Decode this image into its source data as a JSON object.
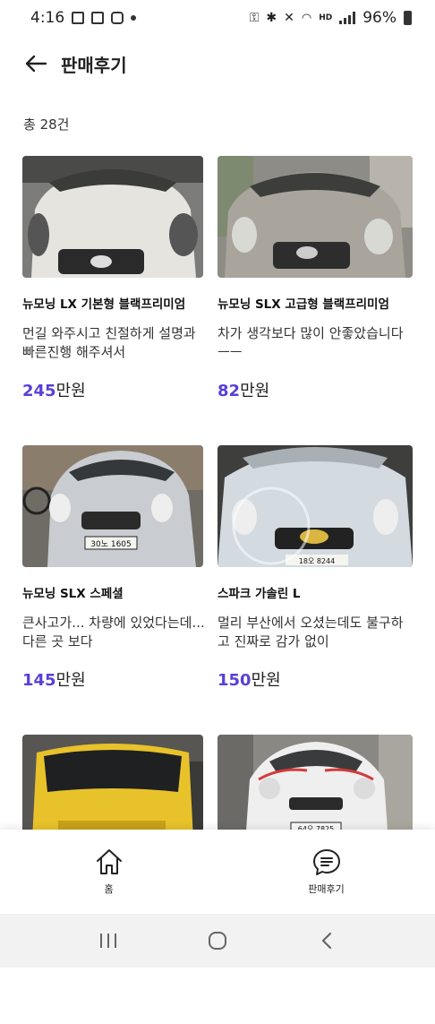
{
  "status_bar": {
    "time": "4:16",
    "battery": "96%"
  },
  "header": {
    "title": "판매후기"
  },
  "count_label": "총 28건",
  "reviews": [
    {
      "name": "뉴모닝 LX 기본형 블랙프리미엄",
      "review": "먼길 와주시고 친절하게 설명과 빠른진행 해주셔서",
      "price": "245",
      "unit": "만원",
      "color": "#e6e4df"
    },
    {
      "name": "뉴모닝 SLX 고급형 블랙프리미엄",
      "review": "차가 생각보다 많이 안좋았습니다ㅡㅡ",
      "price": "82",
      "unit": "만원",
      "color": "#a9a59d"
    },
    {
      "name": "뉴모닝 SLX 스페셜",
      "review": "큰사고가... 차량에 있었다는데... 다른 곳 보다",
      "price": "145",
      "unit": "만원",
      "color": "#c9ccd0",
      "plate": "30노 1605"
    },
    {
      "name": "스파크 가솔린 L",
      "review": "멀리 부산에서 오셨는데도 불구하고 진짜로 감가 없이",
      "price": "150",
      "unit": "만원",
      "color": "#d3dae0",
      "plate": "18오 8244"
    },
    {
      "name": "",
      "review": "",
      "price": "",
      "unit": "",
      "color": "#e8c22a"
    },
    {
      "name": "",
      "review": "",
      "price": "",
      "unit": "",
      "color": "#efefef",
      "plate": "64오 7825"
    }
  ],
  "bottom_nav": {
    "home": "홈",
    "reviews": "판매후기"
  },
  "colors": {
    "accent": "#5b3fd6"
  }
}
